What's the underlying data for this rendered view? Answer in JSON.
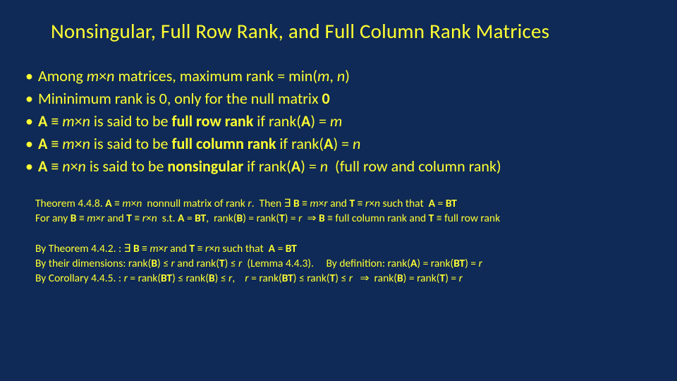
{
  "title": "Nonsingular, Full Row Rank, and Full Column Rank Matrices",
  "bullets": [
    "Among <span class='i'>m</span>×<span class='i'>n</span> matrices, maximum rank = min(<span class='i'>m</span>, <span class='i'>n</span>)",
    "Mininimum rank is 0, only for the null matrix <span class='b'>0</span>",
    "<span class='b'>A</span> ≡ <span class='i'>m</span>×<span class='i'>n</span> is said to be <span class='b'>full row rank</span> if rank(<span class='b'>A</span>) = <span class='i'>m</span>",
    "<span class='b'>A</span> ≡ <span class='i'>m</span>×<span class='i'>n</span> is said to be <span class='b'>full column rank</span> if rank(<span class='b'>A</span>) = <span class='i'>n</span>",
    "<span class='b'>A</span> ≡ <span class='i'>n</span>×<span class='i'>n</span> is said to be <span class='b'>nonsingular</span> if rank(<span class='b'>A</span>) = <span class='i'>n</span>&nbsp;&nbsp;(full row and column rank)"
  ],
  "theorem": "Theorem 4.4.8. <span class='b'>A</span> ≡ <span class='i'>m</span>×<span class='i'>n</span>&nbsp; nonnull matrix of rank <span class='i'>r</span>.&nbsp; Then ∃ <span class='b'>B</span> ≡ <span class='i'>m</span>×<span class='i'>r</span> and <span class='b'>T</span> ≡ <span class='i'>r</span>×<span class='i'>n</span> such that&nbsp; <span class='b'>A</span> = <span class='b'>BT</span><br>For any <span class='b'>B</span> ≡ <span class='i'>m</span>×<span class='i'>r</span> and <span class='b'>T</span> ≡ <span class='i'>r</span>×<span class='i'>n</span>&nbsp; s.t. <span class='b'>A</span> = <span class='b'>BT</span>,&nbsp; rank(<span class='b'>B</span>) = rank(<span class='b'>T</span>) = <span class='i'>r</span>&nbsp; ⇒ <span class='b'>B</span> ≡ full column rank and <span class='b'>T</span> ≡ full row rank",
  "proof": "By Theorem 4.4.2. : ∃ <span class='b'>B</span> ≡ <span class='i'>m</span>×<span class='i'>r</span> and <span class='b'>T</span> ≡ <span class='i'>r</span>×<span class='i'>n</span> such that&nbsp; <span class='b'>A</span> = <span class='b'>BT</span><br>By their dimensions: rank(<span class='b'>B</span>) ≤ <span class='i'>r</span> and rank(<span class='b'>T</span>) ≤ <span class='i'>r</span>&nbsp; (Lemma 4.4.3).&nbsp;&nbsp;&nbsp;&nbsp; By definition: rank(<span class='b'>A</span>) = rank(<span class='b'>BT</span>) = <span class='i'>r</span><br>By Corollary 4.4.5. : <span class='i'>r</span> = rank(<span class='b'>BT</span>) ≤ rank(<span class='b'>B</span>) ≤ <span class='i'>r</span>,&nbsp;&nbsp;&nbsp; <span class='i'>r</span> = rank(<span class='b'>BT</span>) ≤ rank(<span class='b'>T</span>) ≤ <span class='i'>r</span>&nbsp;&nbsp; ⇒&nbsp; rank(<span class='b'>B</span>) = rank(<span class='b'>T</span>) = <span class='i'>r</span>"
}
